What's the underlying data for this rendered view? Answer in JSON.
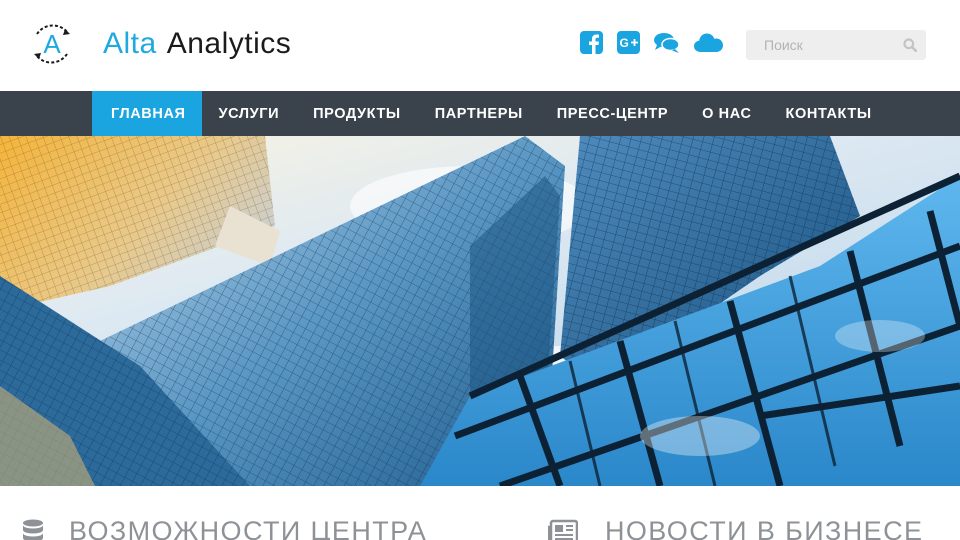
{
  "header": {
    "logo_letter": "A",
    "brand_part1": "Alta",
    "brand_part2": "Analytics",
    "search": {
      "placeholder": "Поиск",
      "value": ""
    },
    "social": [
      "facebook-icon",
      "google-plus-icon",
      "chat-icon",
      "cloud-icon"
    ]
  },
  "nav": {
    "items": [
      {
        "label": "ГЛАВНАЯ",
        "active": true
      },
      {
        "label": "УСЛУГИ",
        "active": false
      },
      {
        "label": "ПРОДУКТЫ",
        "active": false
      },
      {
        "label": "ПАРТНЕРЫ",
        "active": false
      },
      {
        "label": "ПРЕСС-ЦЕНТР",
        "active": false
      },
      {
        "label": "О НАС",
        "active": false
      },
      {
        "label": "КОНТАКТЫ",
        "active": false
      }
    ]
  },
  "sections": {
    "left_title": "ВОЗМОЖНОСТИ ЦЕНТРА",
    "right_title": "НОВОСТИ В БИЗНЕСЕ"
  },
  "colors": {
    "accent": "#1aa5e0",
    "nav_bg": "#3a424b",
    "heading_gray": "#8e9296"
  }
}
